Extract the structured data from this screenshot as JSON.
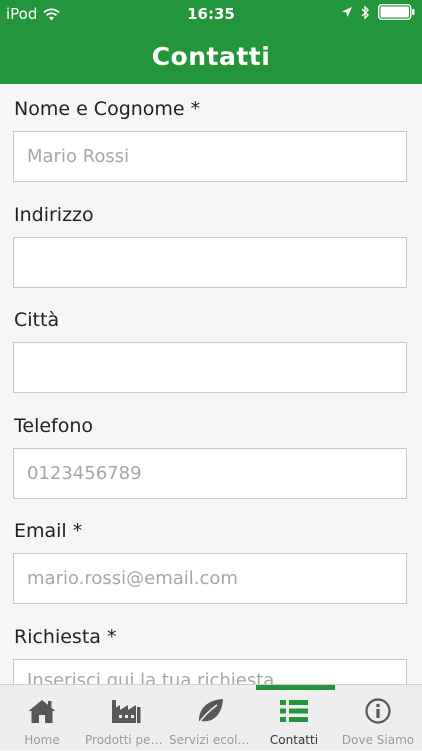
{
  "status": {
    "carrier": "iPod",
    "time": "16:35"
  },
  "nav": {
    "title": "Contatti"
  },
  "form": {
    "name_label": "Nome e Cognome *",
    "name_placeholder": "Mario Rossi",
    "address_label": "Indirizzo",
    "address_placeholder": "",
    "city_label": "Città",
    "city_placeholder": "",
    "phone_label": "Telefono",
    "phone_placeholder": "0123456789",
    "email_label": "Email *",
    "email_placeholder": "mario.rossi@email.com",
    "request_label": "Richiesta *",
    "request_placeholder": "Inserisci qui la tua richiesta"
  },
  "tabs": [
    {
      "label": "Home",
      "icon": "home-icon"
    },
    {
      "label": "Prodotti petro...",
      "icon": "factory-icon"
    },
    {
      "label": "Servizi ecolog...",
      "icon": "leaf-icon"
    },
    {
      "label": "Contatti",
      "icon": "list-icon"
    },
    {
      "label": "Dove Siamo",
      "icon": "info-icon"
    }
  ],
  "colors": {
    "brand_green": "#23963b",
    "placeholder_gray": "#a7a7a7"
  }
}
